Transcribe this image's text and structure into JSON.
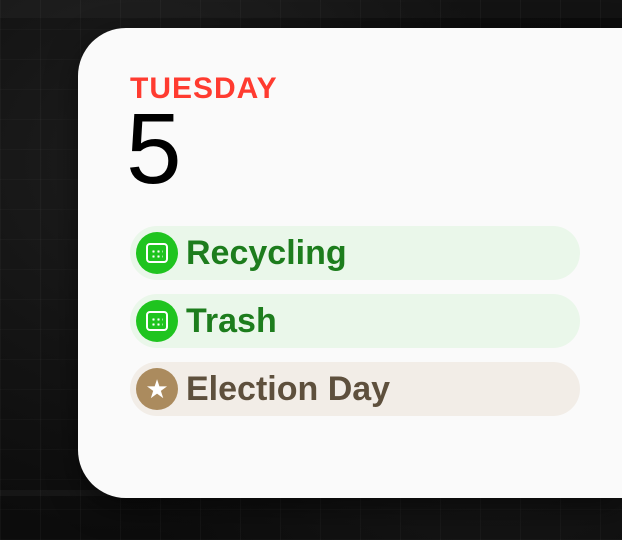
{
  "widget": {
    "day_name": "TUESDAY",
    "day_number": "5",
    "events": [
      {
        "title": "Recycling",
        "style": "green",
        "icon": "calendar"
      },
      {
        "title": "Trash",
        "style": "green",
        "icon": "calendar"
      },
      {
        "title": "Election Day",
        "style": "brown",
        "icon": "star"
      }
    ]
  }
}
